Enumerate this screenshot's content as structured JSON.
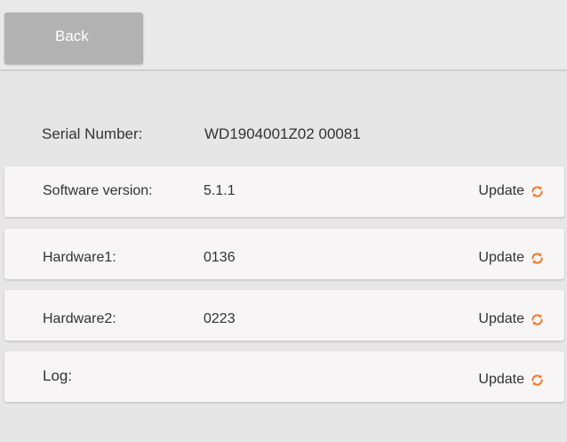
{
  "header": {
    "back_label": "Back"
  },
  "serial": {
    "label": "Serial Number:",
    "value": "WD1904001Z02 00081"
  },
  "rows": [
    {
      "label": "Software version:",
      "value": "5.1.1",
      "action": "Update"
    },
    {
      "label": "Hardware1:",
      "value": "0136",
      "action": "Update"
    },
    {
      "label": "Hardware2:",
      "value": "0223",
      "action": "Update"
    },
    {
      "label": "Log:",
      "value": "",
      "action": "Update"
    }
  ],
  "icons": {
    "refresh": "refresh-icon"
  },
  "colors": {
    "accent": "#f07b2a",
    "back_button": "#b2b2b2",
    "card": "#f7f5f6",
    "background": "#e6e6e6"
  }
}
